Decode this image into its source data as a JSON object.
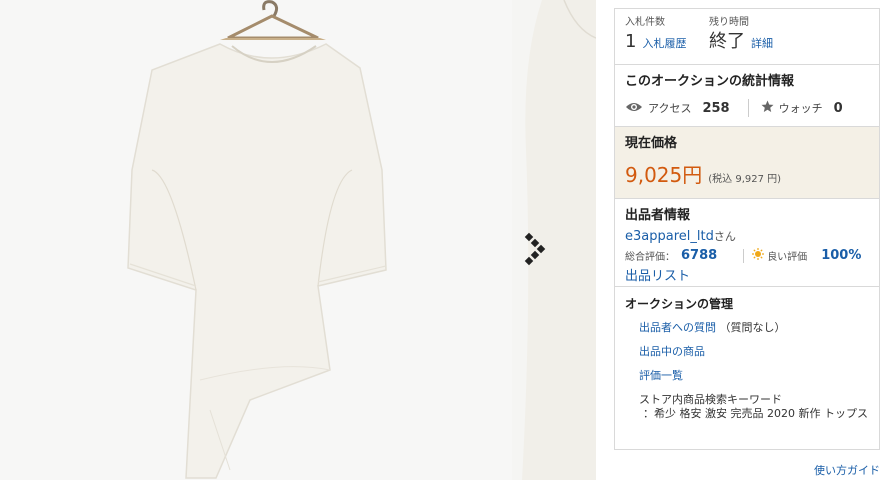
{
  "bid": {
    "count_label": "入札件数",
    "count_value": "1",
    "history_link": "入札履歴",
    "time_label": "残り時間",
    "time_value": "終了",
    "detail_link": "詳細"
  },
  "stats": {
    "title": "このオークションの統計情報",
    "access_label": "アクセス",
    "access_value": "258",
    "watch_label": "ウォッチ",
    "watch_value": "0",
    "icons": [
      "eye-icon",
      "star-icon"
    ]
  },
  "price": {
    "title": "現在価格",
    "value": "9,025円",
    "tax": "(税込 9,927 円)",
    "color": "#d25a0f",
    "background": "#f4f0e6"
  },
  "seller": {
    "title": "出品者情報",
    "name": "e3apparel_ltd",
    "honorific": "さん",
    "rating_label": "総合評価：",
    "rating_value": "6788",
    "good_label": "良い評価",
    "good_value": "100%",
    "listings_link": "出品リスト",
    "icons": [
      "sun-icon"
    ]
  },
  "manage": {
    "title": "オークションの管理",
    "question_link": "出品者への質問",
    "question_note": "（質問なし）",
    "listing_link": "出品中の商品",
    "review_link": "評価一覧",
    "keyword_title": "ストア内商品検索キーワード",
    "keyword_text": "：希少 格安 激安 完売品 2020 新作 トップス"
  },
  "footer": {
    "guide_link": "使い方ガイド"
  },
  "colors": {
    "link": "#1a5ea8",
    "border": "#d9d9d9"
  },
  "gallery": {
    "icons": [
      "next-arrow-icon"
    ]
  }
}
